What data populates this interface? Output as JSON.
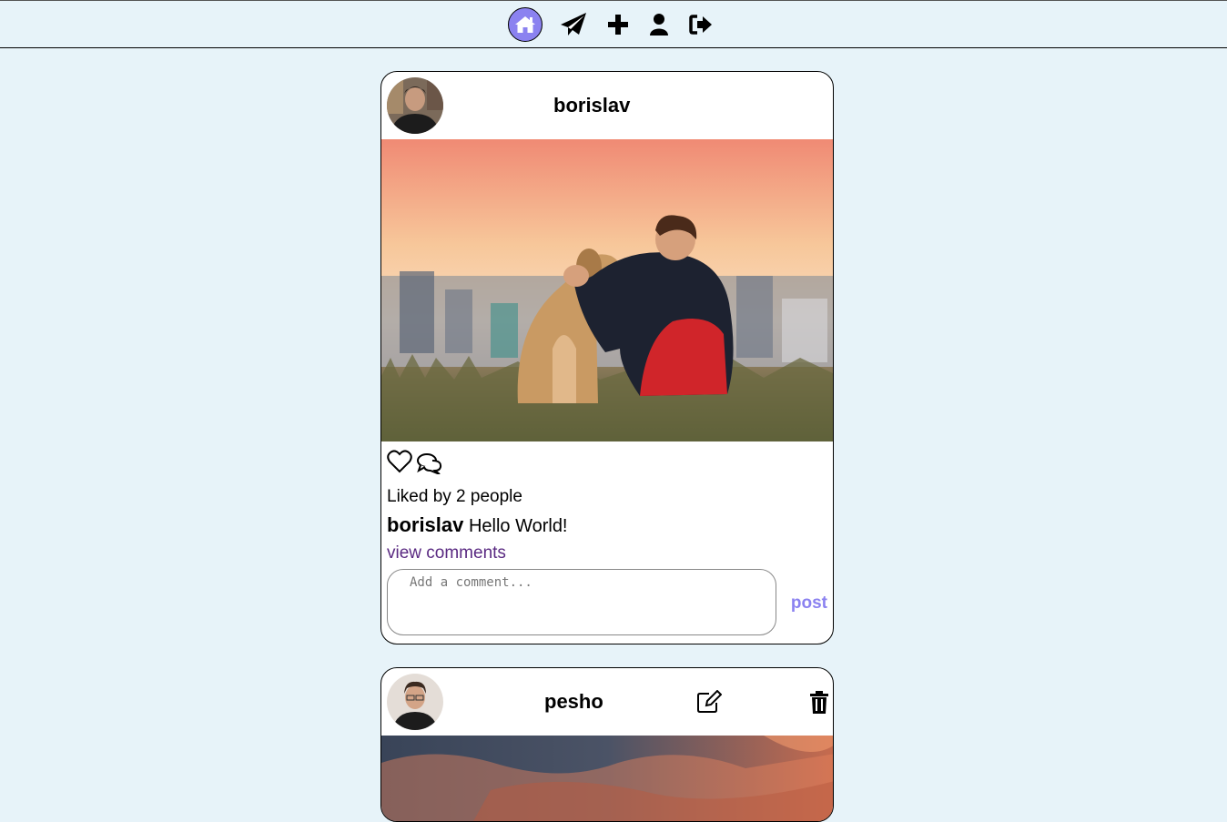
{
  "nav": {
    "items": [
      {
        "name": "home-icon",
        "active": true
      },
      {
        "name": "paper-plane-icon",
        "active": false
      },
      {
        "name": "plus-icon",
        "active": false
      },
      {
        "name": "user-icon",
        "active": false
      },
      {
        "name": "sign-out-icon",
        "active": false
      }
    ]
  },
  "posts": [
    {
      "username": "borislav",
      "likes_text": "Liked by 2 people",
      "caption_user": "borislav",
      "caption_text": "Hello World!",
      "view_comments": "view comments",
      "comment_placeholder": "Add a comment...",
      "post_label": "post"
    },
    {
      "username": "pesho"
    }
  ],
  "colors": {
    "accent": "#8b82f0",
    "background": "#e7f3f9",
    "link": "#5a2a82"
  }
}
